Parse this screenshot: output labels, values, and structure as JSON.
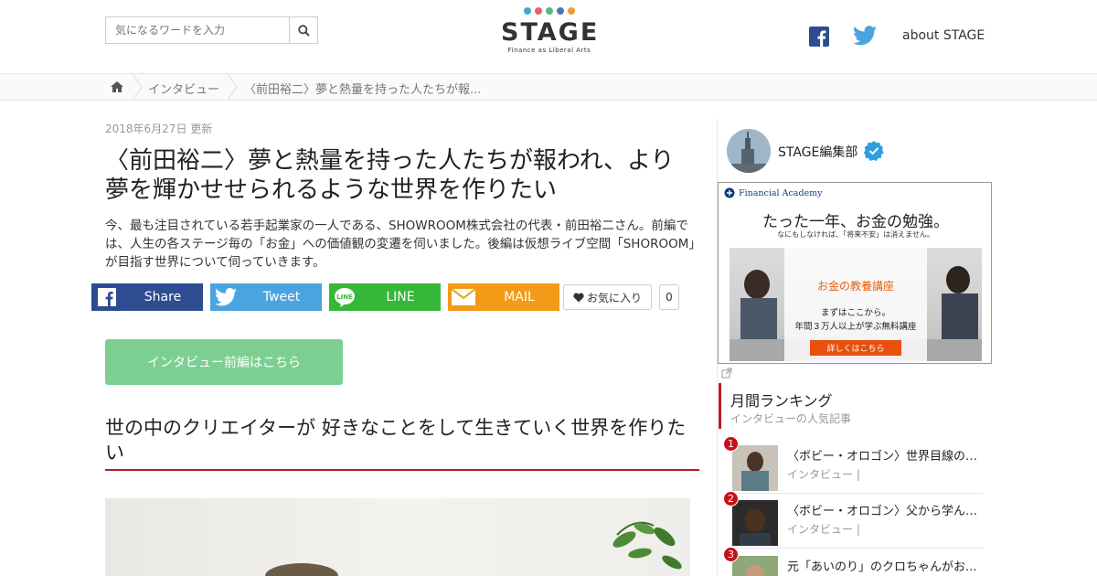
{
  "header": {
    "search_placeholder": "気になるワードを入力",
    "logo_word": "STAGE",
    "logo_tagline": "Finance as Liberal Arts",
    "logo_dots": [
      "#3fa9d6",
      "#e95b6f",
      "#5bb785",
      "#4b73b8",
      "#f09a37"
    ],
    "about_label": "about STAGE"
  },
  "breadcrumb": {
    "items": [
      "インタビュー",
      "〈前田裕二〉夢と熱量を持った人たちが報..."
    ]
  },
  "article": {
    "date": "2018年6月27日 更新",
    "title": "〈前田裕二〉夢と熱量を持った人たちが報われ、より夢を輝かせせられるような世界を作りたい",
    "lead": "今、最も注目されている若手起業家の一人である、SHOWROOM株式会社の代表・前田裕二さん。前編では、人生の各ステージ毎の「お金」への価値観の変遷を伺いました。後編は仮想ライブ空間「SHOROOM」が目指す世界について伺っていきます。",
    "share": [
      {
        "label": "Share",
        "color": "#2d4d90"
      },
      {
        "label": "Tweet",
        "color": "#4ba3df"
      },
      {
        "label": "LINE",
        "color": "#35b739"
      },
      {
        "label": "MAIL",
        "color": "#f39a17"
      }
    ],
    "favorite_label": "お気に入り",
    "favorite_count": "0",
    "prev_button": "インタビュー前編はこちら",
    "section_heading": "世の中のクリエイターが 好きなことをして生きていく世界を作りたい"
  },
  "sidebar": {
    "author_name": "STAGE編集部",
    "ad": {
      "brand": "Financial Academy",
      "headline": "たった一年、お金の勉強。",
      "sub": "なにもしなければ、「将来不安」は消えません。",
      "course": "お金の教養講座",
      "line1": "まずはここから。",
      "line2": "年間３万人以上が学ぶ無料講座",
      "cta": "詳しくはこちら"
    },
    "ranking_title": "月間ランキング",
    "ranking_sub": "インタビューの人気記事",
    "ranking": [
      {
        "rank": "1",
        "headline": "〈ボビー・オロゴン〉世界目線のお金...",
        "category": "インタビュー |"
      },
      {
        "rank": "2",
        "headline": "〈ボビー・オロゴン〉父から学んだ...",
        "category": "インタビュー |"
      },
      {
        "rank": "3",
        "headline": "元「あいのり」のクロちゃんがお...",
        "category": ""
      }
    ]
  }
}
